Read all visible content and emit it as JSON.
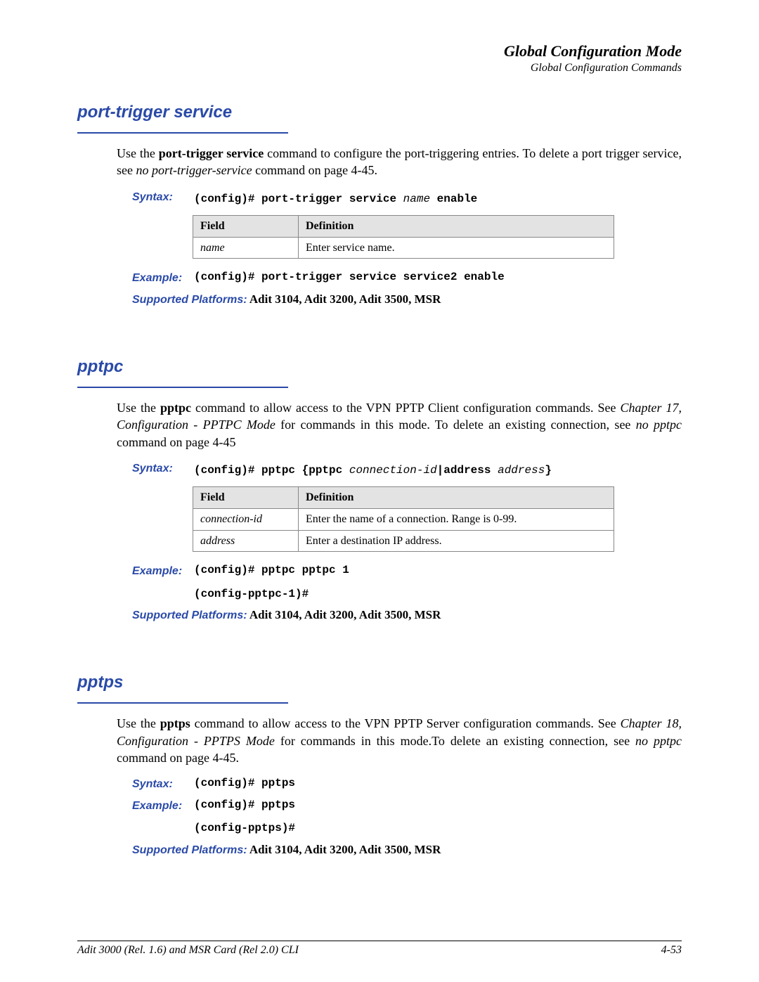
{
  "header": {
    "title": "Global Configuration Mode",
    "subtitle": "Global Configuration Commands"
  },
  "sections": {
    "port_trigger": {
      "heading": "port-trigger service",
      "intro_pre": "Use the ",
      "intro_bold": "port-trigger service",
      "intro_mid": " command to configure the port-triggering entries. To delete a port trigger service, see ",
      "intro_ital": "no port-trigger-service",
      "intro_post": " command on page 4-45.",
      "syntax_label": "Syntax:",
      "syntax_pre": "(config)# port-trigger service ",
      "syntax_var": "name",
      "syntax_post": " enable",
      "table": {
        "h1": "Field",
        "h2": "Definition",
        "rows": [
          {
            "field": "name",
            "def": "Enter service name."
          }
        ]
      },
      "example_label": "Example:",
      "example_line1": "(config)# port-trigger service service2 enable",
      "supported_label": "Supported Platforms:",
      "supported_value": " Adit 3104, Adit 3200, Adit 3500, MSR"
    },
    "pptpc": {
      "heading": "pptpc",
      "intro_pre": "Use the ",
      "intro_bold": "pptpc",
      "intro_mid": " command to allow access to the VPN PPTP Client configuration commands. See ",
      "intro_ital": "Chapter 17, Configuration - PPTPC Mode",
      "intro_mid2": " for commands in this mode. To delete an existing connection, see ",
      "intro_ital2": "no pptpc",
      "intro_post": " command on page 4-45",
      "syntax_label": "Syntax:",
      "syntax_pre": "(config)# pptpc {pptpc ",
      "syntax_var1": "connection-id",
      "syntax_mid": "|address ",
      "syntax_var2": "address",
      "syntax_post": "}",
      "table": {
        "h1": "Field",
        "h2": "Definition",
        "rows": [
          {
            "field": "connection-id",
            "def": "Enter the name of a connection. Range is 0-99."
          },
          {
            "field": "address",
            "def": "Enter a destination IP address."
          }
        ]
      },
      "example_label": "Example:",
      "example_line1": "(config)# pptpc pptpc 1",
      "example_line2": "(config-pptpc-1)#",
      "supported_label": "Supported Platforms:",
      "supported_value": " Adit 3104, Adit 3200, Adit 3500, MSR"
    },
    "pptps": {
      "heading": "pptps",
      "intro_pre": "Use the ",
      "intro_bold": "pptps",
      "intro_mid": " command to allow access to the VPN PPTP Server configuration commands. See ",
      "intro_ital": "Chapter 18, Configuration - PPTPS Mode",
      "intro_mid2": " for commands in this mode.To delete an existing connection, see ",
      "intro_ital2": "no pptpc",
      "intro_post": " command on page 4-45.",
      "syntax_label": "Syntax:",
      "syntax_line": "(config)# pptps",
      "example_label": "Example:",
      "example_line1": "(config)# pptps",
      "example_line2": "(config-pptps)#",
      "supported_label": "Supported Platforms:",
      "supported_value": " Adit 3104, Adit 3200, Adit 3500, MSR"
    }
  },
  "footer": {
    "left": "Adit 3000 (Rel. 1.6) and MSR Card (Rel 2.0) CLI",
    "right": "4-53"
  }
}
